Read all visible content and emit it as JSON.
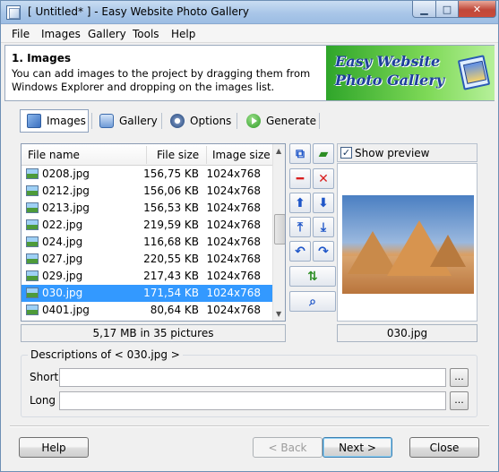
{
  "window": {
    "title": "[ Untitled* ] - Easy Website Photo Gallery",
    "min_icon": "minimize-icon",
    "max_icon": "maximize-icon",
    "close_icon": "close-icon"
  },
  "menu": [
    {
      "label": "File"
    },
    {
      "label": "Images"
    },
    {
      "label": "Gallery"
    },
    {
      "label": "Tools"
    },
    {
      "label": "Help"
    }
  ],
  "header": {
    "title": "1. Images",
    "description": "You can add images to the project by dragging them from Windows Explorer and dropping on the images list.",
    "banner_line1": "Easy Website",
    "banner_line2": "Photo Gallery"
  },
  "tabs": [
    {
      "label": "Images",
      "icon": "images-icon"
    },
    {
      "label": "Gallery",
      "icon": "gallery-icon"
    },
    {
      "label": "Options",
      "icon": "options-gear-icon"
    },
    {
      "label": "Generate",
      "icon": "generate-play-icon"
    }
  ],
  "file_list": {
    "columns": [
      "File name",
      "File size",
      "Image size"
    ],
    "rows": [
      {
        "name": "0208.jpg",
        "size": "156,75 KB",
        "dims": "1024x768",
        "selected": false
      },
      {
        "name": "0212.jpg",
        "size": "156,06 KB",
        "dims": "1024x768",
        "selected": false
      },
      {
        "name": "0213.jpg",
        "size": "156,53 KB",
        "dims": "1024x768",
        "selected": false
      },
      {
        "name": "022.jpg",
        "size": "219,59 KB",
        "dims": "1024x768",
        "selected": false
      },
      {
        "name": "024.jpg",
        "size": "116,68 KB",
        "dims": "1024x768",
        "selected": false
      },
      {
        "name": "027.jpg",
        "size": "220,55 KB",
        "dims": "1024x768",
        "selected": false
      },
      {
        "name": "029.jpg",
        "size": "217,43 KB",
        "dims": "1024x768",
        "selected": false
      },
      {
        "name": "030.jpg",
        "size": "171,54 KB",
        "dims": "1024x768",
        "selected": true
      },
      {
        "name": "0401.jpg",
        "size": "80,64 KB",
        "dims": "1024x768",
        "selected": false
      }
    ],
    "status": "5,17 MB in 35 pictures"
  },
  "toolbar_icons": [
    "copy-images-icon",
    "add-folder-icon",
    "remove-icon",
    "clear-all-icon",
    "move-up-icon",
    "move-down-icon",
    "move-top-icon",
    "move-bottom-icon",
    "rotate-left-icon",
    "rotate-right-icon",
    "sort-icon",
    "preview-zoom-icon"
  ],
  "preview": {
    "show_label": "Show preview",
    "checked": true,
    "filename": "030.jpg"
  },
  "descriptions": {
    "legend": "Descriptions of < 030.jpg >",
    "short_label": "Short",
    "long_label": "Long",
    "short_value": "",
    "long_value": "",
    "browse_label": "..."
  },
  "buttons": {
    "help": "Help",
    "back": "< Back",
    "next": "Next >",
    "close": "Close"
  },
  "colors": {
    "selection": "#3399ff",
    "banner_green": "#2fa52a",
    "banner_text": "#1e3e9a"
  }
}
